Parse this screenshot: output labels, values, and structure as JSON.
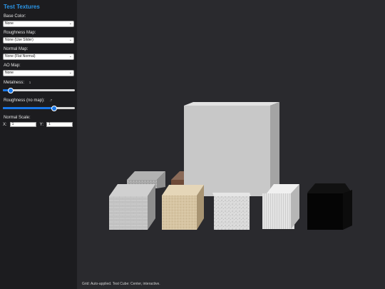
{
  "panel": {
    "title": "Test Textures",
    "base_color": {
      "label": "Base Color:",
      "value": "None"
    },
    "roughness_map": {
      "label": "Roughness Map:",
      "value": "None (Use Slider)"
    },
    "normal_map": {
      "label": "Normal Map:",
      "value": "None (Flat Normal)"
    },
    "ao_map": {
      "label": "AO Map:",
      "value": "None"
    },
    "metalness": {
      "label": "Metalness:",
      "value_text": "1",
      "fraction": 0.1
    },
    "roughness": {
      "label": "Roughness (no map):",
      "value_text": ".7",
      "fraction": 0.7
    },
    "normal_scale": {
      "label": "Normal Scale:",
      "x_label": "X:",
      "x_value": "1",
      "y_label": "Y:",
      "y_value": "1"
    }
  },
  "status_text": "Grid: Auto-applied. Test Cube: Center, interactive.",
  "cubes": [
    {
      "name": "large-gray-cube",
      "material": "gray"
    },
    {
      "name": "back-granite-cube",
      "material": "granite"
    },
    {
      "name": "back-wood-cube",
      "material": "wood"
    },
    {
      "name": "brick-cube",
      "material": "brick"
    },
    {
      "name": "sand-cube",
      "material": "sand"
    },
    {
      "name": "speckled-stone-cube",
      "material": "speckled"
    },
    {
      "name": "birch-wood-cube",
      "material": "birch"
    },
    {
      "name": "black-cube",
      "material": "black"
    }
  ],
  "colors": {
    "accent": "#2b95e6",
    "slider": "#1877e8",
    "background": "#2a2a2e",
    "panel": "#1c1c1f"
  }
}
